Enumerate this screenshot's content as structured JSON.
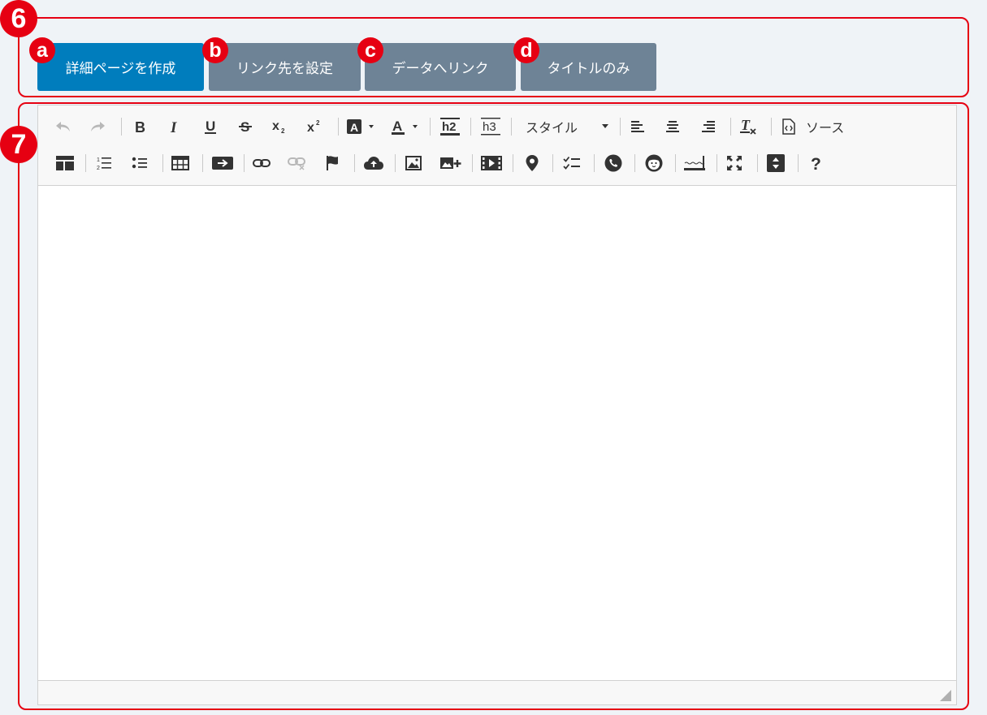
{
  "annotations": {
    "box6": "6",
    "box7": "7",
    "a": "a",
    "b": "b",
    "c": "c",
    "d": "d"
  },
  "buttons": {
    "create_detail_page": "詳細ページを作成",
    "set_link_target": "リンク先を設定",
    "link_to_data": "データへリンク",
    "title_only": "タイトルのみ"
  },
  "toolbar": {
    "style_label": "スタイル",
    "source_label": "ソース",
    "h2_label": "h2",
    "h3_label": "h3",
    "help_label": "?"
  },
  "colors": {
    "accent": "#007dbd",
    "secondary_button": "#6e8396",
    "annotation_red": "#e60012"
  }
}
